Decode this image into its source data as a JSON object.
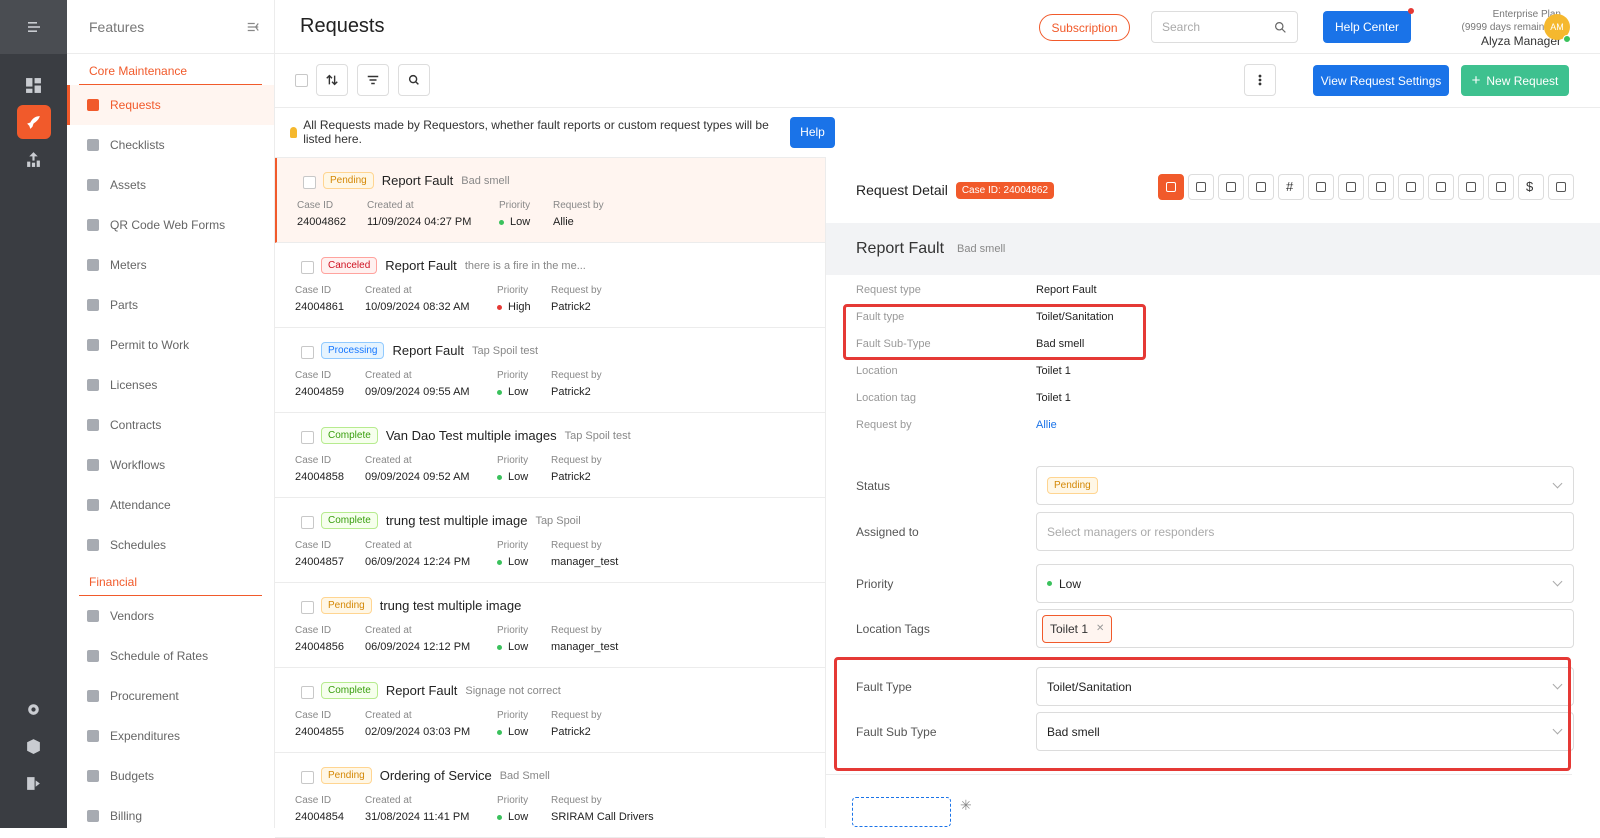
{
  "sidebar": {
    "title": "Features",
    "sections": [
      {
        "label": "Core Maintenance",
        "items": [
          "Requests",
          "Checklists",
          "Assets",
          "QR Code Web Forms",
          "Meters",
          "Parts",
          "Permit to Work",
          "Licenses",
          "Contracts",
          "Workflows",
          "Attendance",
          "Schedules"
        ]
      },
      {
        "label": "Financial",
        "items": [
          "Vendors",
          "Schedule of Rates",
          "Procurement",
          "Expenditures",
          "Budgets",
          "Billing"
        ]
      }
    ],
    "active_item": "Requests"
  },
  "header": {
    "title": "Requests",
    "subscription": "Subscription",
    "search_placeholder": "Search",
    "help_center": "Help Center",
    "plan": "Enterprise Plan",
    "plan_remaining": "(9999 days remaining)",
    "user_name": "Alyza Manager",
    "avatar_initials": "AM"
  },
  "toolbar": {
    "view_settings": "View Request Settings",
    "new_request": "New Request"
  },
  "info": {
    "text": "All Requests made by Requestors, whether fault reports or custom request types will be listed here.",
    "help": "Help"
  },
  "list_labels": {
    "case_id": "Case ID",
    "created_at": "Created at",
    "priority": "Priority",
    "request_by": "Request by"
  },
  "requests": [
    {
      "status": "Pending",
      "name": "Report Fault",
      "desc": "Bad smell",
      "case_id": "24004862",
      "created": "11/09/2024 04:27 PM",
      "priority": "Low",
      "by": "Allie"
    },
    {
      "status": "Canceled",
      "name": "Report Fault",
      "desc": "there is a fire in the me...",
      "case_id": "24004861",
      "created": "10/09/2024 08:32 AM",
      "priority": "High",
      "by": "Patrick2"
    },
    {
      "status": "Processing",
      "name": "Report Fault",
      "desc": "Tap Spoil  test",
      "case_id": "24004859",
      "created": "09/09/2024 09:55 AM",
      "priority": "Low",
      "by": "Patrick2"
    },
    {
      "status": "Complete",
      "name": "Van Dao Test multiple images",
      "desc": "Tap Spoil  test",
      "case_id": "24004858",
      "created": "09/09/2024 09:52 AM",
      "priority": "Low",
      "by": "Patrick2"
    },
    {
      "status": "Complete",
      "name": "trung test multiple image",
      "desc": "Tap Spoil",
      "case_id": "24004857",
      "created": "06/09/2024 12:24 PM",
      "priority": "Low",
      "by": "manager_test"
    },
    {
      "status": "Pending",
      "name": "trung test multiple image",
      "desc": "",
      "case_id": "24004856",
      "created": "06/09/2024 12:12 PM",
      "priority": "Low",
      "by": "manager_test"
    },
    {
      "status": "Complete",
      "name": "Report Fault",
      "desc": "Signage not correct",
      "case_id": "24004855",
      "created": "02/09/2024 03:03 PM",
      "priority": "Low",
      "by": "Patrick2"
    },
    {
      "status": "Pending",
      "name": "Ordering of Service",
      "desc": "Bad Smell",
      "case_id": "24004854",
      "created": "31/08/2024 11:41 PM",
      "priority": "Low",
      "by": "SRIRAM Call Drivers"
    }
  ],
  "colors": {
    "accent": "#f15a2b",
    "blue": "#1a73e8",
    "green": "#3ec18f",
    "low": "#3ac15c",
    "high": "#e53935",
    "highlight": "#e53935"
  },
  "detail": {
    "title": "Request Detail",
    "case_badge": "Case ID: 24004862",
    "name": "Report Fault",
    "sub": "Bad smell",
    "info": [
      {
        "k": "Request type",
        "v": "Report Fault"
      },
      {
        "k": "Fault type",
        "v": "Toilet/Sanitation"
      },
      {
        "k": "Fault Sub-Type",
        "v": "Bad smell"
      },
      {
        "k": "Location",
        "v": "Toilet 1"
      },
      {
        "k": "Location tag",
        "v": "Toilet 1"
      },
      {
        "k": "Request by",
        "v": "Allie"
      }
    ],
    "form": {
      "status_label": "Status",
      "status_value": "Pending",
      "assigned_label": "Assigned to",
      "assigned_placeholder": "Select managers or responders",
      "priority_label": "Priority",
      "priority_value": "Low",
      "tags_label": "Location Tags",
      "tag_value": "Toilet 1",
      "fault_type_label": "Fault Type",
      "fault_type_value": "Toilet/Sanitation",
      "fault_sub_label": "Fault Sub Type",
      "fault_sub_value": "Bad smell"
    }
  }
}
